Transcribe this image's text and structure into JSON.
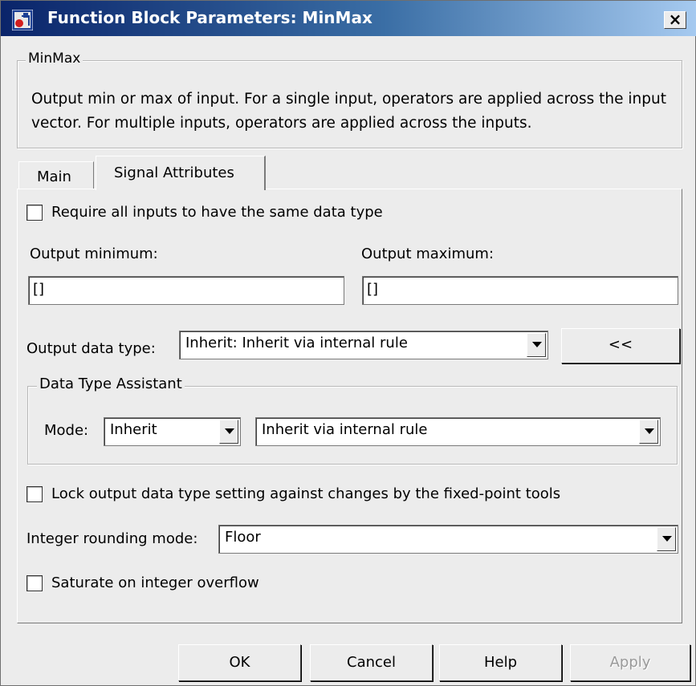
{
  "window": {
    "title": "Function Block Parameters: MinMax",
    "close_label": "×"
  },
  "block": {
    "group_label": "MinMax",
    "description": "Output min or max of input.  For a single input, operators are applied across the input vector.  For multiple inputs, operators are applied across the inputs."
  },
  "tabs": [
    {
      "label": "Main",
      "selected": false
    },
    {
      "label": "Signal Attributes",
      "selected": true
    }
  ],
  "signal_attributes": {
    "same_type_checkbox": {
      "label": "Require all inputs to have the same data type",
      "checked": false
    },
    "output_minimum": {
      "label": "Output minimum:",
      "value": "[]"
    },
    "output_maximum": {
      "label": "Output maximum:",
      "value": "[]"
    },
    "output_data_type": {
      "label": "Output data type:",
      "value": "Inherit: Inherit via internal rule"
    },
    "assistant_toggle_label": "<<",
    "assistant": {
      "group_label": "Data Type Assistant",
      "mode_label": "Mode:",
      "mode_value": "Inherit",
      "rule_value": "Inherit via internal rule"
    },
    "lock_checkbox": {
      "label": "Lock output data type setting against changes by the fixed-point tools",
      "checked": false
    },
    "rounding": {
      "label": "Integer rounding mode:",
      "value": "Floor"
    },
    "saturate_checkbox": {
      "label": "Saturate on integer overflow",
      "checked": false
    }
  },
  "buttons": {
    "ok": "OK",
    "cancel": "Cancel",
    "help": "Help",
    "apply": "Apply"
  }
}
